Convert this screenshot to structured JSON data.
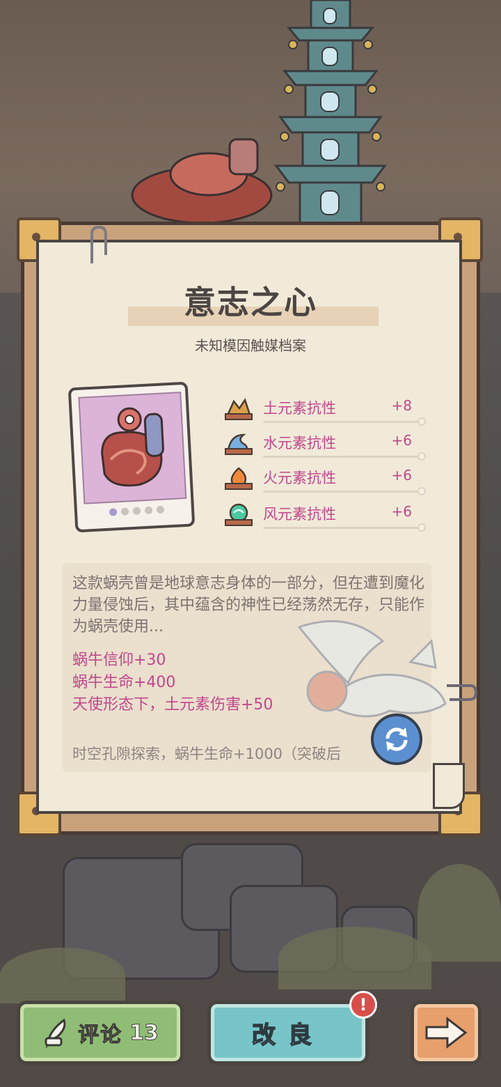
{
  "item": {
    "title": "意志之心",
    "subtitle": "未知模因触媒档案"
  },
  "stats": [
    {
      "name": "土元素抗性",
      "value": "+8",
      "icon": "earth-element-icon",
      "color": "#e0b060"
    },
    {
      "name": "水元素抗性",
      "value": "+6",
      "icon": "water-element-icon",
      "color": "#7ab0e0"
    },
    {
      "name": "火元素抗性",
      "value": "+6",
      "icon": "fire-element-icon",
      "color": "#f08a3a"
    },
    {
      "name": "风元素抗性",
      "value": "+6",
      "icon": "wind-element-icon",
      "color": "#4cc9a0"
    }
  ],
  "description": "这款蜗壳曾是地球意志身体的一部分，但在遭到魔化力量侵蚀后，其中蕴含的神性已经荡然无存，只能作为蜗壳使用...",
  "bonuses": [
    "蜗牛信仰+30",
    "蜗牛生命+400",
    "天使形态下，土元素伤害+50"
  ],
  "footnote": "时空孔隙探索，蜗牛生命+1000（突破后",
  "buttons": {
    "comment_label": "评论",
    "comment_count": "13",
    "upgrade_label": "改良",
    "upgrade_badge": "!"
  },
  "colors": {
    "accent_pink": "#c0478c",
    "comment_green": "#8fbd76",
    "upgrade_teal": "#78c5c9",
    "next_orange": "#e79f6c"
  }
}
